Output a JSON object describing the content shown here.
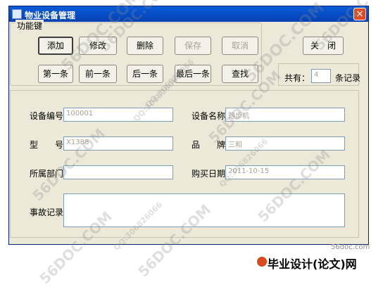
{
  "window": {
    "title": "物业设备管理",
    "close_symbol": "×"
  },
  "group": {
    "legend": "功能键"
  },
  "buttons": {
    "add": "添加",
    "edit": "修改",
    "delete": "删除",
    "save": "保存",
    "cancel": "取消",
    "first": "第一条",
    "prev": "前一条",
    "next": "后一条",
    "last": "最后一条",
    "find": "查找",
    "close": "关　闭"
  },
  "count": {
    "prefix": "共有：",
    "value": "4",
    "suffix": "条记录"
  },
  "fields": {
    "equipment_no": {
      "label": "设备编号",
      "value": "100001"
    },
    "equipment_name": {
      "label": "设备名称",
      "value": "跑步机"
    },
    "model": {
      "label": "型　　号",
      "value": "X1388"
    },
    "brand": {
      "label": "品　　牌",
      "value": "三和"
    },
    "department": {
      "label": "所属部门",
      "value": ""
    },
    "purchase_date": {
      "label": "购买日期",
      "value": "2011-10-15"
    },
    "incident_record": {
      "label": "事故记录",
      "value": ""
    }
  },
  "watermarks": {
    "site": "56DOC.COM",
    "qq": "QQ:306826066",
    "footer_logo": "毕业设计(论文)网",
    "footer_site": "56doc.com"
  }
}
